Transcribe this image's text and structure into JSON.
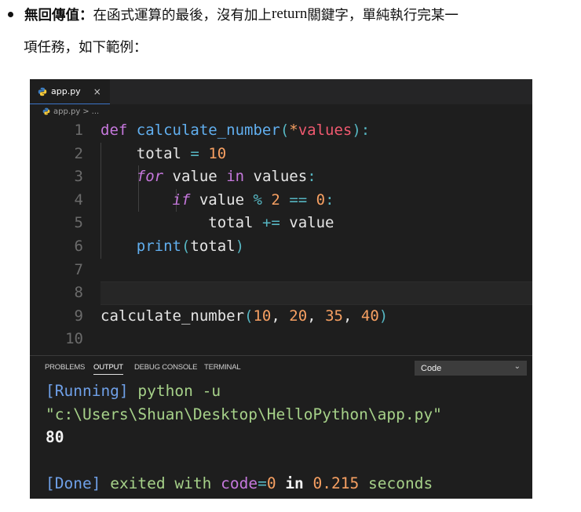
{
  "prose": {
    "term": "無回傳值：",
    "text_a": "在函式運算的最後，沒有加上 ",
    "keyword": "return",
    "text_b": " 關鍵字，單純執行完某一",
    "line2": "項任務，如下範例："
  },
  "editor": {
    "tab": {
      "filename": "app.py",
      "close": "×"
    },
    "breadcrumb": {
      "file": "app.py",
      "sep": ">",
      "more": "..."
    },
    "line_numbers": [
      "1",
      "2",
      "3",
      "4",
      "5",
      "6",
      "7",
      "8",
      "9",
      "10"
    ],
    "code": {
      "l1": {
        "def": "def",
        "name": "calculate_number",
        "open": "(",
        "star": "*",
        "param": "values",
        "close": "):"
      },
      "l2": {
        "var": "total",
        "eq": "=",
        "num": "10"
      },
      "l3": {
        "for": "for",
        "var": "value",
        "in": "in",
        "iter": "values",
        "colon": ":"
      },
      "l4": {
        "if": "if",
        "var": "value",
        "mod": "%",
        "n2": "2",
        "eqeq": "==",
        "n0": "0",
        "colon": ":"
      },
      "l5": {
        "var": "total",
        "op": "+=",
        "val": "value"
      },
      "l6": {
        "fn": "print",
        "open": "(",
        "arg": "total",
        "close": ")"
      },
      "l9": {
        "name": "calculate_number",
        "open": "(",
        "a": "10",
        "c1": ",",
        "b": "20",
        "c2": ",",
        "c": "35",
        "c3": ",",
        "d": "40",
        "close": ")"
      }
    }
  },
  "panel": {
    "tabs": [
      "PROBLEMS",
      "OUTPUT",
      "DEBUG CONSOLE",
      "TERMINAL"
    ],
    "active_tab": "OUTPUT",
    "select_value": "Code",
    "output": {
      "running_tag": "[Running]",
      "cmd": "python -u",
      "path": "\"c:\\Users\\Shuan\\Desktop\\HelloPython\\app.py\"",
      "result": "80",
      "done_tag": "[Done]",
      "exited": "exited with",
      "code_label": "code",
      "code_eq": "=",
      "code_val": "0",
      "in": "in",
      "time": "0.215",
      "seconds": "seconds"
    }
  }
}
